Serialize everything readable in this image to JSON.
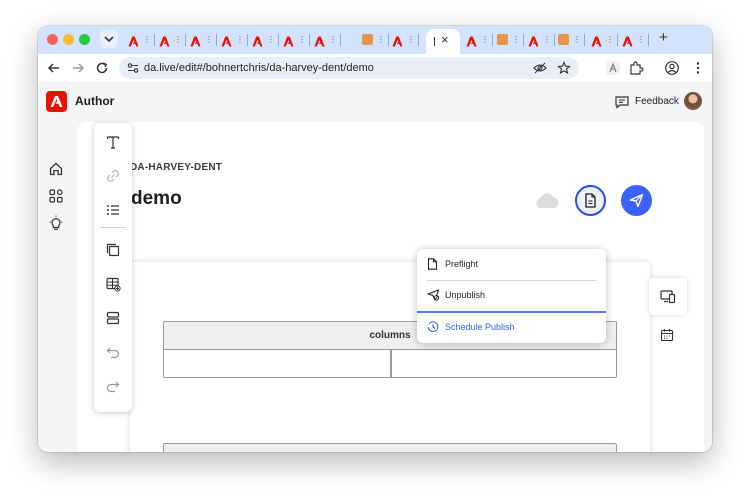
{
  "browser": {
    "url": "da.live/edit#/bohnertchris/da-harvey-dent/demo",
    "tabs": [
      {
        "favicon": "adobe-icon"
      },
      {
        "favicon": "adobe-icon"
      },
      {
        "favicon": "adobe-icon"
      },
      {
        "favicon": "adobe-icon"
      },
      {
        "favicon": "adobe-icon"
      },
      {
        "favicon": "adobe-icon"
      },
      {
        "favicon": "adobe-icon"
      },
      {
        "favicon": "orange-app-icon"
      },
      {
        "favicon": "adobe-icon"
      },
      {
        "favicon": "adobe-icon"
      },
      {
        "favicon": "orange-app-icon"
      },
      {
        "favicon": "adobe-icon"
      },
      {
        "favicon": "orange-app-icon"
      },
      {
        "favicon": "adobe-icon"
      },
      {
        "favicon": "adobe-icon"
      }
    ],
    "new_tab_label": "+",
    "active_tab_close": "×"
  },
  "app": {
    "title": "Author",
    "feedback_label": "Feedback",
    "breadcrumb": "DA-HARVEY-DENT",
    "page_title": "demo",
    "accent_color": "#3b63fb",
    "brand_color": "#eb1000"
  },
  "publish_menu": {
    "items": [
      {
        "label": "Preflight",
        "icon": "document-icon"
      },
      {
        "label": "Unpublish",
        "icon": "unpublish-icon"
      },
      {
        "label": "Schedule Publish",
        "icon": "clock-icon"
      }
    ]
  },
  "editor": {
    "block_name": "columns"
  }
}
